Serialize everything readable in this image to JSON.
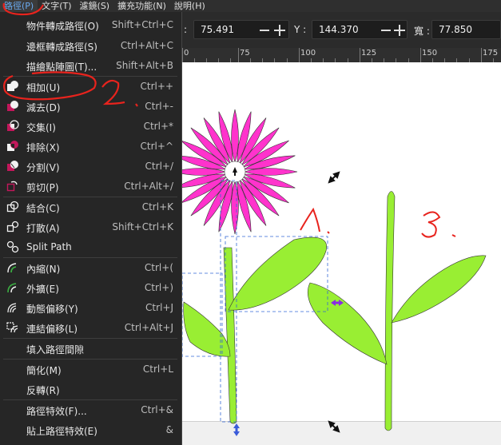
{
  "menubar": {
    "items": [
      "路徑(P)",
      "文字(T)",
      "濾鏡(S)",
      "擴充功能(N)",
      "說明(H)"
    ]
  },
  "toolbar": {
    "x_label": ":",
    "x_value": "75.491",
    "y_label": "Y :",
    "y_value": "144.370",
    "w_label": "寬 :",
    "w_value": "77.850"
  },
  "ruler": {
    "labels": [
      "0",
      "75",
      "100",
      "125",
      "150",
      "175"
    ]
  },
  "path_menu": {
    "items": [
      {
        "label": "物件轉成路徑(O)",
        "shortcut": "Shift+Ctrl+C",
        "icon": "none"
      },
      {
        "label": "邊框轉成路徑(S)",
        "shortcut": "Ctrl+Alt+C",
        "icon": "none"
      },
      {
        "label": "描繪點陣圖(T)...",
        "shortcut": "Shift+Alt+B",
        "icon": "none"
      },
      {
        "label": "相加(U)",
        "shortcut": "Ctrl++",
        "icon": "path-union-icon"
      },
      {
        "label": "減去(D)",
        "shortcut": "Ctrl+-",
        "icon": "path-difference-icon"
      },
      {
        "label": "交集(I)",
        "shortcut": "Ctrl+*",
        "icon": "path-intersection-icon"
      },
      {
        "label": "排除(X)",
        "shortcut": "Ctrl+^",
        "icon": "path-exclusion-icon"
      },
      {
        "label": "分割(V)",
        "shortcut": "Ctrl+/",
        "icon": "path-division-icon"
      },
      {
        "label": "剪切(P)",
        "shortcut": "Ctrl+Alt+/",
        "icon": "path-cut-icon"
      },
      {
        "label": "結合(C)",
        "shortcut": "Ctrl+K",
        "icon": "path-combine-icon"
      },
      {
        "label": "打散(A)",
        "shortcut": "Shift+Ctrl+K",
        "icon": "path-break-apart-icon"
      },
      {
        "label": "Split Path",
        "shortcut": "",
        "icon": "split-path-icon"
      },
      {
        "label": "內縮(N)",
        "shortcut": "Ctrl+(",
        "icon": "path-inset-icon"
      },
      {
        "label": "外擴(E)",
        "shortcut": "Ctrl+)",
        "icon": "path-outset-icon"
      },
      {
        "label": "動態偏移(Y)",
        "shortcut": "Ctrl+J",
        "icon": "dynamic-offset-icon"
      },
      {
        "label": "連結偏移(L)",
        "shortcut": "Ctrl+Alt+J",
        "icon": "linked-offset-icon"
      },
      {
        "label": "填入路徑間隙",
        "shortcut": "",
        "icon": "none"
      },
      {
        "label": "簡化(M)",
        "shortcut": "Ctrl+L",
        "icon": "none"
      },
      {
        "label": "反轉(R)",
        "shortcut": "",
        "icon": "none"
      },
      {
        "label": "路徑特效(F)...",
        "shortcut": "Ctrl+&",
        "icon": "none"
      },
      {
        "label": "貼上路徑特效(E)",
        "shortcut": "&",
        "icon": "none"
      }
    ]
  },
  "annotations": {
    "one": "1.",
    "two": "2.",
    "three": "3."
  },
  "colors": {
    "petal": "#ff33cc",
    "leaf": "#99ee33",
    "outline": "#333333",
    "annotation_red": "#e8231d",
    "selection_blue": "#3367d6",
    "handle_purple": "#8a2be2",
    "menu_bg": "#262626",
    "menu_text": "#e8e8e8",
    "menubar_active": "#6aaaf0"
  }
}
